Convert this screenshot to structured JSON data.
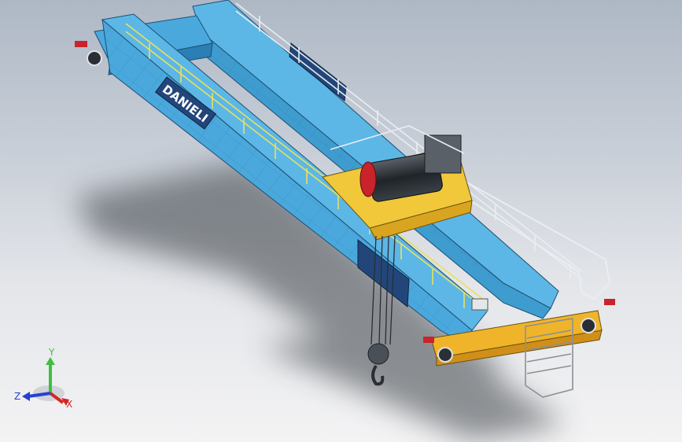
{
  "model": {
    "brand_text": "DANIELI",
    "colors": {
      "girder_blue": "#4aa8dc",
      "girder_dark": "#2b7fb4",
      "end_carriage_yellow": "#f0b42a",
      "rail_yellow": "#d8c84a",
      "trolley_red": "#c9232b",
      "drum_dark": "#2a2f35",
      "panel_navy": "#23467a"
    }
  },
  "triad": {
    "x_label": "X",
    "y_label": "Y",
    "z_label": "Z",
    "x_color": "#d62626",
    "y_color": "#3fbf3f",
    "z_color": "#2a3fd0"
  }
}
